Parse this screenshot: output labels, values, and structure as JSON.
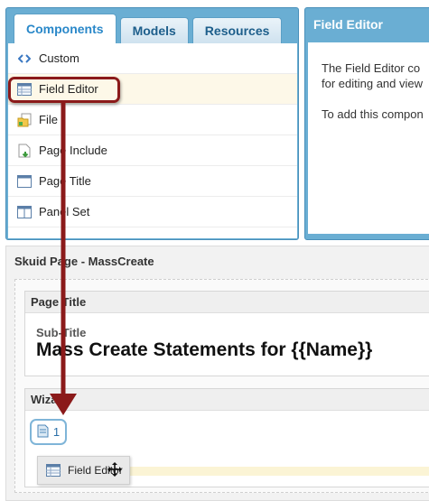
{
  "component_panel": {
    "tabs": [
      "Components",
      "Models",
      "Resources"
    ],
    "items": [
      {
        "label": "Custom",
        "icon": "code-brackets-icon"
      },
      {
        "label": "Field Editor",
        "icon": "table-grid-icon"
      },
      {
        "label": "File",
        "icon": "folder-file-icon"
      },
      {
        "label": "Page Include",
        "icon": "page-include-icon"
      },
      {
        "label": "Page Title",
        "icon": "page-title-icon"
      },
      {
        "label": "Panel Set",
        "icon": "panel-set-icon"
      }
    ]
  },
  "field_editor_panel": {
    "title": "Field Editor",
    "line1": "The Field Editor co",
    "line2": "for editing and view",
    "line3": "To add this compon"
  },
  "skuid_page": {
    "title": "Skuid Page - MassCreate",
    "page_title": {
      "header": "Page Title",
      "subtitle": "Sub-Title",
      "main_title": "Mass Create Statements for {{Name}}"
    },
    "wizard": {
      "header": "Wizard",
      "step_label": "1",
      "drag_label": "Field Editor"
    }
  },
  "colors": {
    "panel_blue": "#6aaed3",
    "tab_text": "#1d5e8b",
    "callout": "#8b1a1a",
    "highlight": "#fdf8e8",
    "drop_zone": "#fbf4d5"
  }
}
